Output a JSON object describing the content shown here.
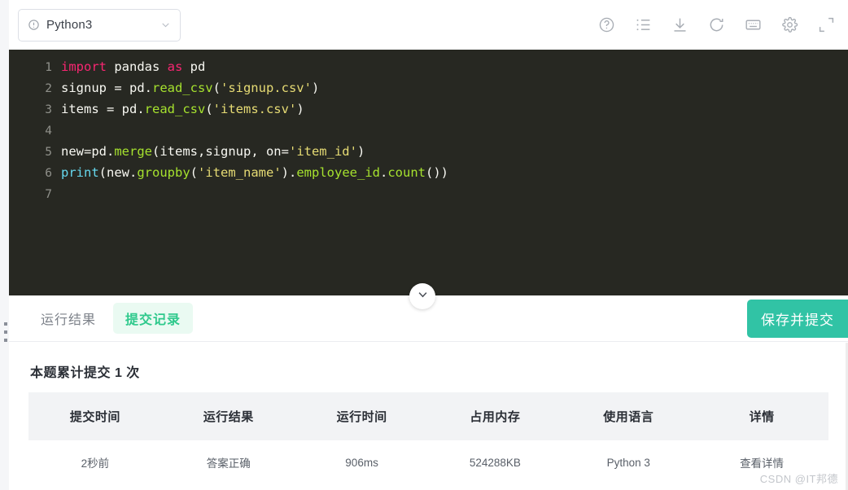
{
  "language_selector": {
    "icon": "info-circle-icon",
    "value": "Python3",
    "chevron": "chevron-down-icon"
  },
  "toolbar": {
    "icons": [
      {
        "name": "help-icon",
        "title": "帮助"
      },
      {
        "name": "list-icon",
        "title": "列表"
      },
      {
        "name": "download-icon",
        "title": "下载"
      },
      {
        "name": "refresh-icon",
        "title": "重置"
      },
      {
        "name": "keyboard-icon",
        "title": "快捷键"
      },
      {
        "name": "settings-gear-icon",
        "title": "设置"
      },
      {
        "name": "fullscreen-icon",
        "title": "全屏"
      }
    ]
  },
  "editor": {
    "theme_background": "#272822",
    "lines": [
      {
        "number": "1",
        "tokens": [
          {
            "t": "import",
            "c": "kw"
          },
          {
            "t": " pandas ",
            "c": "def"
          },
          {
            "t": "as",
            "c": "kw"
          },
          {
            "t": " pd",
            "c": "def"
          }
        ]
      },
      {
        "number": "2",
        "tokens": [
          {
            "t": "signup = pd.",
            "c": "def"
          },
          {
            "t": "read_csv",
            "c": "fn"
          },
          {
            "t": "(",
            "c": "op"
          },
          {
            "t": "'signup.csv'",
            "c": "str"
          },
          {
            "t": ")",
            "c": "op"
          }
        ]
      },
      {
        "number": "3",
        "tokens": [
          {
            "t": "items = pd.",
            "c": "def"
          },
          {
            "t": "read_csv",
            "c": "fn"
          },
          {
            "t": "(",
            "c": "op"
          },
          {
            "t": "'items.csv'",
            "c": "str"
          },
          {
            "t": ")",
            "c": "op"
          }
        ]
      },
      {
        "number": "4",
        "tokens": []
      },
      {
        "number": "5",
        "tokens": [
          {
            "t": "new=pd.",
            "c": "def"
          },
          {
            "t": "merge",
            "c": "fn"
          },
          {
            "t": "(items,signup, on=",
            "c": "op"
          },
          {
            "t": "'item_id'",
            "c": "str"
          },
          {
            "t": ")",
            "c": "op"
          }
        ]
      },
      {
        "number": "6",
        "tokens": [
          {
            "t": "print",
            "c": "bi"
          },
          {
            "t": "(new.",
            "c": "op"
          },
          {
            "t": "groupby",
            "c": "fn"
          },
          {
            "t": "(",
            "c": "op"
          },
          {
            "t": "'item_name'",
            "c": "str"
          },
          {
            "t": ").",
            "c": "op"
          },
          {
            "t": "employee_id",
            "c": "fn"
          },
          {
            "t": ".",
            "c": "op"
          },
          {
            "t": "count",
            "c": "fn"
          },
          {
            "t": "())",
            "c": "op"
          }
        ]
      },
      {
        "number": "7",
        "tokens": []
      }
    ]
  },
  "collapse_toggle": {
    "icon": "chevron-down-icon"
  },
  "tabs": [
    {
      "label": "运行结果",
      "active": false
    },
    {
      "label": "提交记录",
      "active": true
    }
  ],
  "submit_button": {
    "label": "保存并提交",
    "color": "#31c3a5"
  },
  "results": {
    "title": "本题累计提交 1 次",
    "columns": [
      "提交时间",
      "运行结果",
      "运行时间",
      "占用内存",
      "使用语言",
      "详情"
    ],
    "rows": [
      {
        "submit_time": "2秒前",
        "result": "答案正确",
        "run_time": "906ms",
        "memory": "524288KB",
        "language": "Python 3",
        "detail": "查看详情"
      }
    ],
    "result_ok_color": "#44c08b"
  },
  "watermark": {
    "text": "CSDN @IT邦德"
  }
}
